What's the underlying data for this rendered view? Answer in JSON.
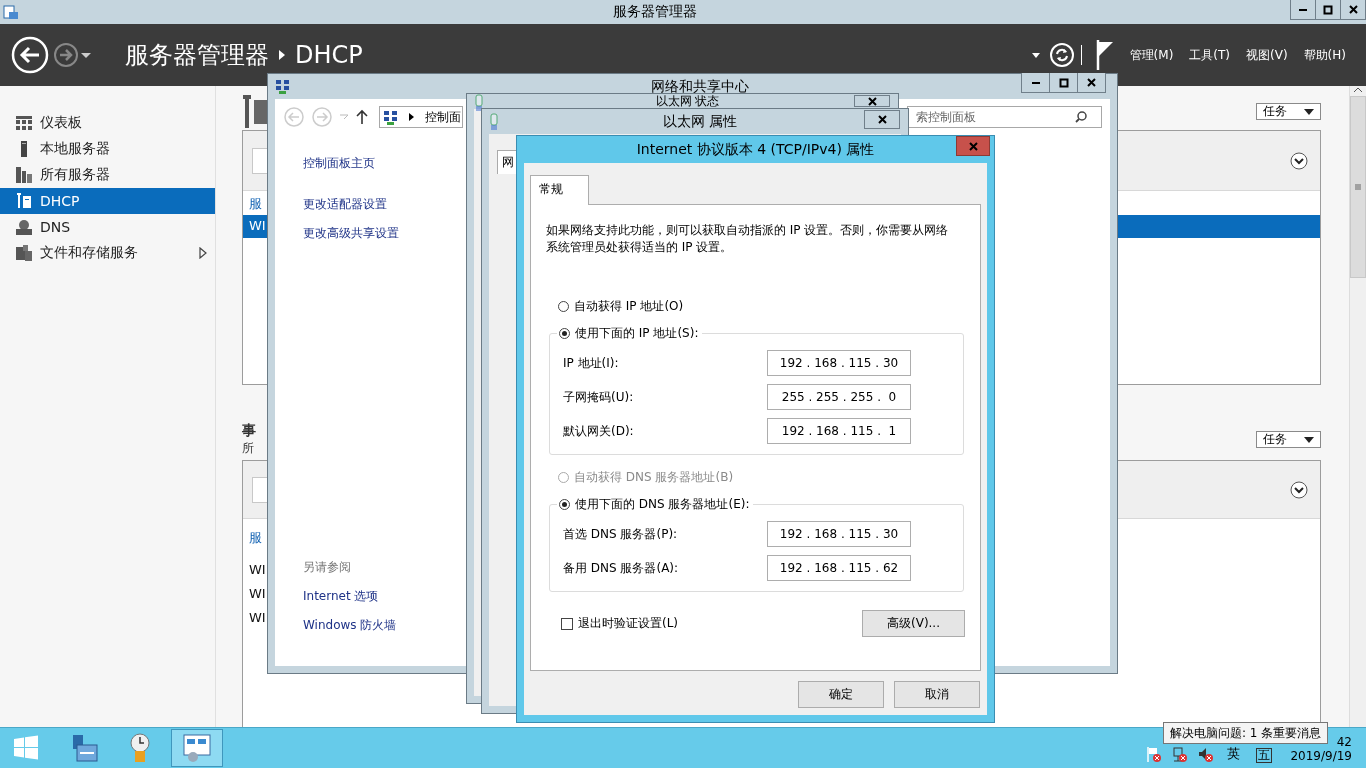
{
  "server_manager": {
    "title": "服务器管理器",
    "breadcrumb": [
      "服务器管理器",
      "DHCP"
    ],
    "menus": [
      "管理(M)",
      "工具(T)",
      "视图(V)",
      "帮助(H)"
    ],
    "sidebar": {
      "items": [
        {
          "label": "仪表板",
          "selected": false
        },
        {
          "label": "本地服务器",
          "selected": false
        },
        {
          "label": "所有服务器",
          "selected": false
        },
        {
          "label": "DHCP",
          "selected": true
        },
        {
          "label": "DNS",
          "selected": false
        },
        {
          "label": "文件和存储服务",
          "selected": false,
          "expandable": true
        }
      ]
    },
    "servers_panel": {
      "task_button": "任务",
      "column_header": "服",
      "rows": [
        {
          "name": "WI",
          "selected": true
        }
      ]
    },
    "events_panel": {
      "title": "事",
      "subtitle": "所",
      "task_button": "任务",
      "column_header": "服",
      "rows": [
        {
          "name": "WI",
          "selected": false
        },
        {
          "name": "WI",
          "selected": false
        },
        {
          "name": "WI",
          "selected": false
        }
      ]
    }
  },
  "network_center": {
    "title": "网络和共享中心",
    "address": "控制面",
    "search": {
      "placeholder": "索控制面板"
    },
    "links": [
      "控制面板主页",
      "更改适配器设置",
      "更改高级共享设置"
    ],
    "see_also": {
      "title": "另请参阅",
      "links": [
        "Internet 选项",
        "Windows 防火墙"
      ]
    }
  },
  "ethernet_status": {
    "title": "以太网 状态"
  },
  "ethernet_properties": {
    "title": "以太网 属性",
    "tab": "网"
  },
  "ipv4_dialog": {
    "title": "Internet 协议版本 4 (TCP/IPv4) 属性",
    "tabs": [
      {
        "label": "常规",
        "selected": true
      }
    ],
    "description": "如果网络支持此功能，则可以获取自动指派的 IP 设置。否则，你需要从网络系统管理员处获得适当的 IP 设置。",
    "ip_mode": [
      {
        "label": "自动获得 IP 地址(O)",
        "selected": false,
        "disabled": false
      },
      {
        "label": "使用下面的 IP 地址(S):",
        "selected": true,
        "disabled": false
      }
    ],
    "ip_fields": [
      {
        "label": "IP 地址(I):",
        "value": "192 . 168 . 115 . 30"
      },
      {
        "label": "子网掩码(U):",
        "value": "255 . 255 . 255 .  0"
      },
      {
        "label": "默认网关(D):",
        "value": "192 . 168 . 115 .  1"
      }
    ],
    "dns_mode": [
      {
        "label": "自动获得 DNS 服务器地址(B)",
        "selected": false,
        "disabled": true
      },
      {
        "label": "使用下面的 DNS 服务器地址(E):",
        "selected": true,
        "disabled": false
      }
    ],
    "dns_fields": [
      {
        "label": "首选 DNS 服务器(P):",
        "value": "192 . 168 . 115 . 30"
      },
      {
        "label": "备用 DNS 服务器(A):",
        "value": "192 . 168 . 115 . 62"
      }
    ],
    "validate_on_exit": {
      "label": "退出时验证设置(L)",
      "checked": false
    },
    "advanced_button": "高级(V)...",
    "buttons": [
      "确定",
      "取消"
    ]
  },
  "taskbar": {
    "pinned": [
      {
        "selected": false
      },
      {
        "selected": false
      },
      {
        "selected": false
      },
      {
        "selected": true
      }
    ],
    "tooltip": "解决电脑问题: 1 条重要消息",
    "ime": [
      "英",
      "五"
    ],
    "time": "42",
    "date": "2019/9/19"
  }
}
